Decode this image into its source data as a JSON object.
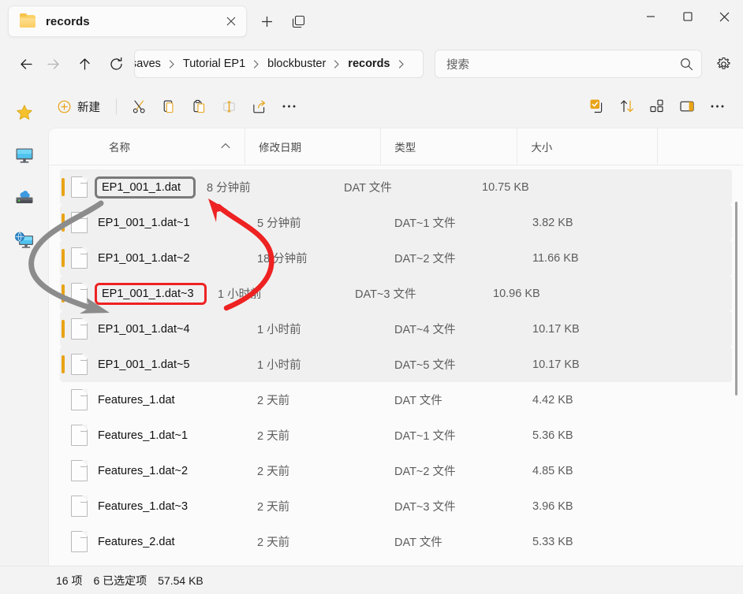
{
  "window": {
    "titlebar": {
      "tab": {
        "label": "records",
        "folder_icon": "folder-icon",
        "close_icon": "close-icon"
      },
      "new_tab_icon": "plus-icon",
      "tab_list_icon": "tab-list-icon",
      "minimize_icon": "minimize-icon",
      "maximize_icon": "maximize-icon",
      "close_icon": "close-icon"
    },
    "addressbar": {
      "back_icon": "arrow-left-icon",
      "forward_icon": "arrow-right-icon",
      "up_icon": "arrow-up-icon",
      "refresh_icon": "refresh-icon",
      "breadcrumb": [
        "saves",
        "Tutorial EP1",
        "blockbuster",
        "records"
      ],
      "breadcrumb_separator": "chevron-right-icon",
      "search": {
        "placeholder": "搜索",
        "value": "",
        "icon": "search-icon"
      },
      "settings_icon": "gear-icon"
    },
    "commandbar": {
      "new_label": "新建",
      "new_icon": "plus-circle-icon",
      "buttons": [
        {
          "name": "cut-button",
          "icon": "scissors-icon"
        },
        {
          "name": "copy-button",
          "icon": "copy-icon"
        },
        {
          "name": "paste-button",
          "icon": "clipboard-icon"
        },
        {
          "name": "rename-button",
          "icon": "rename-icon"
        },
        {
          "name": "share-button",
          "icon": "share-icon"
        },
        {
          "name": "more-button",
          "icon": "ellipsis-icon"
        }
      ],
      "right_buttons": [
        {
          "name": "select-all-button",
          "icon": "checkbox-select-icon"
        },
        {
          "name": "sort-button",
          "icon": "sort-arrows-icon"
        },
        {
          "name": "view-button",
          "icon": "grid-view-icon"
        },
        {
          "name": "preview-pane-button",
          "icon": "preview-pane-icon"
        },
        {
          "name": "see-more-button",
          "icon": "ellipsis-icon"
        }
      ]
    },
    "sidebar": {
      "items": [
        {
          "name": "sidebar-item-favorites",
          "icon": "star-icon"
        },
        {
          "name": "sidebar-item-this-pc",
          "icon": "monitor-icon"
        },
        {
          "name": "sidebar-item-drive",
          "icon": "drive-cloud-icon"
        },
        {
          "name": "sidebar-item-network",
          "icon": "network-pc-icon"
        }
      ]
    },
    "filelist": {
      "columns": [
        {
          "label": "名称",
          "sort": "asc"
        },
        {
          "label": "修改日期"
        },
        {
          "label": "类型"
        },
        {
          "label": "大小"
        }
      ],
      "rows": [
        {
          "name": "EP1_001_1.dat",
          "date": "8 分钟前",
          "type": "DAT 文件",
          "size": "10.75 KB",
          "selected": true,
          "highlight": "gray"
        },
        {
          "name": "EP1_001_1.dat~1",
          "date": "5 分钟前",
          "type": "DAT~1 文件",
          "size": "3.82 KB",
          "selected": true,
          "highlight": ""
        },
        {
          "name": "EP1_001_1.dat~2",
          "date": "18 分钟前",
          "type": "DAT~2 文件",
          "size": "11.66 KB",
          "selected": true,
          "highlight": ""
        },
        {
          "name": "EP1_001_1.dat~3",
          "date": "1 小时前",
          "type": "DAT~3 文件",
          "size": "10.96 KB",
          "selected": true,
          "highlight": "red"
        },
        {
          "name": "EP1_001_1.dat~4",
          "date": "1 小时前",
          "type": "DAT~4 文件",
          "size": "10.17 KB",
          "selected": true,
          "highlight": ""
        },
        {
          "name": "EP1_001_1.dat~5",
          "date": "1 小时前",
          "type": "DAT~5 文件",
          "size": "10.17 KB",
          "selected": true,
          "highlight": ""
        },
        {
          "name": "Features_1.dat",
          "date": "2 天前",
          "type": "DAT 文件",
          "size": "4.42 KB",
          "selected": false,
          "highlight": ""
        },
        {
          "name": "Features_1.dat~1",
          "date": "2 天前",
          "type": "DAT~1 文件",
          "size": "5.36 KB",
          "selected": false,
          "highlight": ""
        },
        {
          "name": "Features_1.dat~2",
          "date": "2 天前",
          "type": "DAT~2 文件",
          "size": "4.85 KB",
          "selected": false,
          "highlight": ""
        },
        {
          "name": "Features_1.dat~3",
          "date": "2 天前",
          "type": "DAT~3 文件",
          "size": "3.96 KB",
          "selected": false,
          "highlight": ""
        },
        {
          "name": "Features_2.dat",
          "date": "2 天前",
          "type": "DAT 文件",
          "size": "5.33 KB",
          "selected": false,
          "highlight": ""
        }
      ]
    },
    "statusbar": {
      "item_count": "16 项",
      "selected_count": "6 已选定项",
      "total_size": "57.54 KB"
    },
    "annotations": {
      "gray_arrow": {
        "name": "gray-flow-arrow",
        "color": "#8c8c8c"
      },
      "red_arrow": {
        "name": "red-flow-arrow",
        "color": "#ee2222"
      },
      "gray_box_color": "#7a7a7a",
      "red_box_color": "#ee2222"
    },
    "colors": {
      "accent": "#e8a317",
      "selection_bar": "#e8a317",
      "row_selected_bg": "#f0f0f0",
      "window_bg": "#f3f3f3",
      "content_bg": "#fbfbfb"
    }
  }
}
